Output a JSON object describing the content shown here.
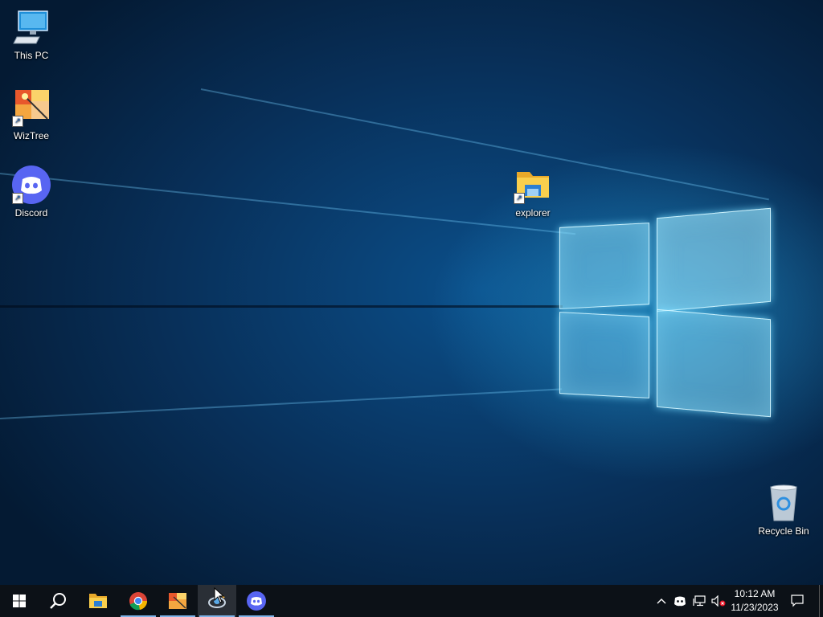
{
  "desktop": {
    "icons": [
      {
        "label": "This PC",
        "icon": "this-pc-icon"
      },
      {
        "label": "WizTree",
        "icon": "wiztree-icon"
      },
      {
        "label": "Discord",
        "icon": "discord-icon"
      },
      {
        "label": "explorer",
        "icon": "folder-icon"
      },
      {
        "label": "Recycle Bin",
        "icon": "recycle-bin-icon"
      }
    ]
  },
  "taskbar": {
    "buttons": [
      "start-icon",
      "search-icon",
      "file-explorer-icon",
      "chrome-icon",
      "wiztree-icon",
      "app-icon",
      "discord-icon"
    ],
    "clock": {
      "time": "10:12 AM",
      "date": "11/23/2023"
    }
  },
  "colors": {
    "taskbar": "#0c1117",
    "accent": "#7fb3e8",
    "discord": "#5865f2"
  }
}
